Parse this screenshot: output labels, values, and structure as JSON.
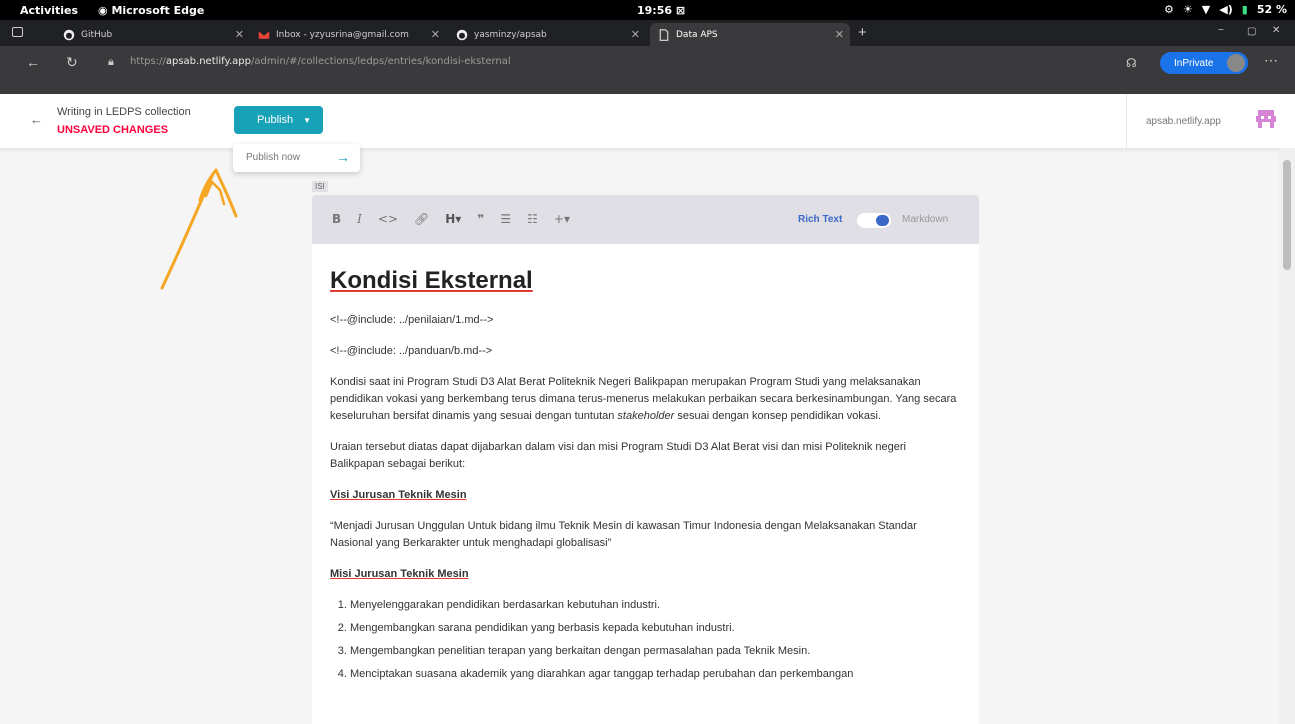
{
  "system_bar": {
    "activities": "Activities",
    "app_name": "Microsoft Edge",
    "clock": "19:56",
    "battery": "52 %"
  },
  "browser": {
    "tabs": [
      {
        "label": "GitHub",
        "icon": "github-icon"
      },
      {
        "label": "Inbox - yzyusrina@gmail.com",
        "icon": "gmail-icon"
      },
      {
        "label": "yasminzy/apsab",
        "icon": "github-icon"
      },
      {
        "label": "Data APS",
        "icon": "page-icon"
      }
    ],
    "url_prefix": "https://",
    "url_host": "apsab.netlify.app",
    "url_path": "/admin/#/collections/ledps/entries/kondisi-eksternal",
    "inprivate_label": "InPrivate"
  },
  "cms": {
    "writing_in": "Writing in LEDPS collection",
    "unsaved": "UNSAVED CHANGES",
    "publish_label": "Publish",
    "publish_now_label": "Publish now",
    "hostname": "apsab.netlify.app",
    "accent_color": "#17a2b8"
  },
  "editor": {
    "field_label": "ISI",
    "rich_text_label": "Rich Text",
    "markdown_label": "Markdown",
    "title": "Kondisi Eksternal",
    "include1": "<!--@include: ../penilaian/1.md-->",
    "include2": "<!--@include: ../panduan/b.md-->",
    "para1_a": "Kondisi saat ini Program Studi D3 Alat Berat Politeknik Negeri Balikpapan merupakan Program Studi yang melaksanakan pendidikan vokasi yang berkembang terus dimana terus-menerus melakukan perbaikan secara berkesinambungan. Yang secara keseluruhan bersifat dinamis yang sesuai dengan tuntutan ",
    "para1_em": "stakeholder",
    "para1_b": " sesuai dengan konsep pendidikan vokasi.",
    "para2": "Uraian tersebut diatas dapat dijabarkan dalam visi dan misi Program Studi D3 Alat Berat visi dan misi Politeknik negeri Balikpapan sebagai berikut:",
    "visi_heading": "Visi Jurusan Teknik Mesin",
    "visi_text": "“Menjadi Jurusan Unggulan Untuk bidang ilmu Teknik Mesin di kawasan Timur Indonesia dengan Melaksanakan Standar Nasional yang Berkarakter untuk menghadapi globalisasi”",
    "misi_heading": "Misi Jurusan Teknik Mesin",
    "misi_items": [
      "Menyelenggarakan pendidikan berdasarkan kebutuhan industri.",
      "Mengembangkan sarana pendidikan yang berbasis kepada kebutuhan industri.",
      "Mengembangkan penelitian terapan yang berkaitan dengan permasalahan pada Teknik Mesin.",
      "Menciptakan suasana akademik yang diarahkan agar tanggap terhadap perubahan dan perkembangan"
    ]
  }
}
